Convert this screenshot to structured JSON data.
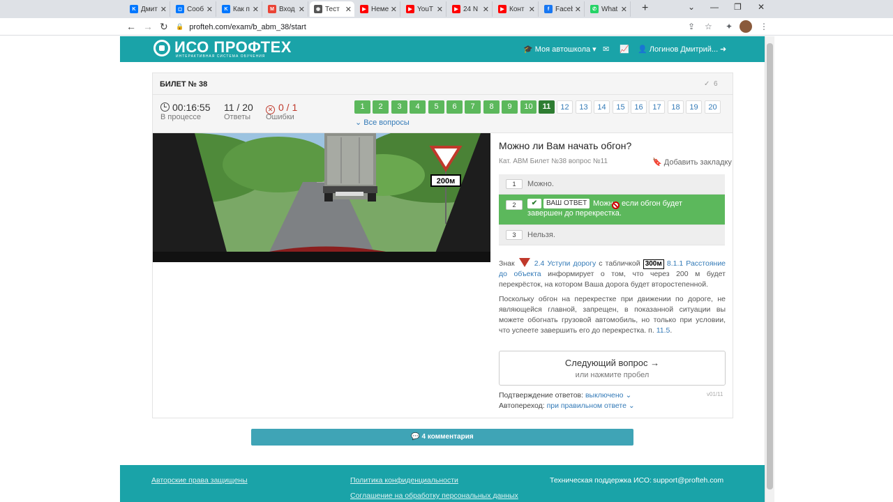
{
  "browser": {
    "tabs": [
      {
        "title": "Дмит",
        "color": "#0077ff",
        "glyph": "K"
      },
      {
        "title": "Сооб",
        "color": "#0077ff",
        "glyph": "◻"
      },
      {
        "title": "Как п",
        "color": "#0077ff",
        "glyph": "K"
      },
      {
        "title": "Вход",
        "color": "#ea4335",
        "glyph": "M"
      },
      {
        "title": "Тест",
        "color": "#555555",
        "glyph": "◉"
      },
      {
        "title": "Неме",
        "color": "#ff0000",
        "glyph": "▶"
      },
      {
        "title": "YouT",
        "color": "#ff0000",
        "glyph": "▶"
      },
      {
        "title": "24 N",
        "color": "#ff0000",
        "glyph": "▶"
      },
      {
        "title": "Конт",
        "color": "#ff0000",
        "glyph": "▶"
      },
      {
        "title": "Faceb",
        "color": "#1877f2",
        "glyph": "f"
      },
      {
        "title": "What",
        "color": "#25d366",
        "glyph": "✆"
      }
    ],
    "active_tab": 4,
    "url": "profteh.com/exam/b_abm_38/start"
  },
  "site": {
    "logo_title": "ИСО ПРОФТЕХ",
    "logo_subtitle": "ИНТЕРАКТИВНАЯ СИСТЕМА ОБУЧЕНИЯ",
    "school_menu": "Моя автошкола",
    "user_name": "Логинов Дмитрий..."
  },
  "ticket": {
    "title": "БИЛЕТ № 38",
    "check_count": "6",
    "timer": "00:16:55",
    "timer_label": "В процессе",
    "answers_value": "11 / 20",
    "answers_label": "Ответы",
    "errors_value": "0 / 1",
    "errors_label": "Ошибки",
    "questions": [
      {
        "n": "1",
        "state": "ok"
      },
      {
        "n": "2",
        "state": "ok"
      },
      {
        "n": "3",
        "state": "ok"
      },
      {
        "n": "4",
        "state": "ok"
      },
      {
        "n": "5",
        "state": "ok"
      },
      {
        "n": "6",
        "state": "ok"
      },
      {
        "n": "7",
        "state": "ok"
      },
      {
        "n": "8",
        "state": "ok"
      },
      {
        "n": "9",
        "state": "ok"
      },
      {
        "n": "10",
        "state": "ok"
      },
      {
        "n": "11",
        "state": "cur"
      },
      {
        "n": "12",
        "state": "todo"
      },
      {
        "n": "13",
        "state": "todo"
      },
      {
        "n": "14",
        "state": "todo"
      },
      {
        "n": "15",
        "state": "todo"
      },
      {
        "n": "16",
        "state": "todo"
      },
      {
        "n": "17",
        "state": "todo"
      },
      {
        "n": "18",
        "state": "todo"
      },
      {
        "n": "19",
        "state": "todo"
      },
      {
        "n": "20",
        "state": "todo"
      }
    ],
    "all_questions": "Все вопросы"
  },
  "question": {
    "sign_plate": "200м",
    "title": "Можно ли Вам начать обгон?",
    "meta": "Кат. ABM   Билет №38   вопрос №11",
    "bookmark": "Добавить закладку",
    "answers": [
      {
        "num": "1",
        "text": "Можно."
      },
      {
        "num": "2",
        "badge": "ВАШ ОТВЕТ",
        "text": "Можно, если обгон будет завершен до перекрестка."
      },
      {
        "num": "3",
        "text": "Нельзя."
      }
    ]
  },
  "explanation": {
    "p1_prefix": "Знак",
    "p1_link1": "2.4 Уступи дорогу",
    "p1_mid": "с табличкой",
    "p1_plate": "300м",
    "p1_link2": "8.1.1 Расстояние до объекта",
    "p1_suffix": "информирует о том, что через 200 м будет перекрёсток, на котором Ваша дорога будет второстепенной.",
    "p2_text": "Поскольку обгон на перекрестке при движении по дороге, не являющейся главной, запрещен, в показанной ситуации вы можете обогнать грузовой автомобиль, но только при условии, что успеете завершить его до перекрестка. п.",
    "p2_link": "11.5",
    "p2_end": "."
  },
  "next": {
    "label": "Следующий вопрос →",
    "hint": "или нажмите пробел"
  },
  "options": {
    "confirm_label": "Подтверждение ответов:",
    "confirm_value": "выключено",
    "auto_label": "Автопереход:",
    "auto_value": "при правильном ответе",
    "version": "v01/11"
  },
  "comments": "4 комментария",
  "footer": {
    "copyright": "Авторские права защищены",
    "privacy": "Политика конфиденциальности",
    "agreement": "Соглашение на обработку персональных данных",
    "support_label": "Техническая поддержка ИСО:",
    "support_email": "support@profteh.com"
  },
  "colors": {
    "brand": "#1aa3a8",
    "correct": "#5cb85c",
    "current": "#2e7d32",
    "link": "#337ab7"
  }
}
